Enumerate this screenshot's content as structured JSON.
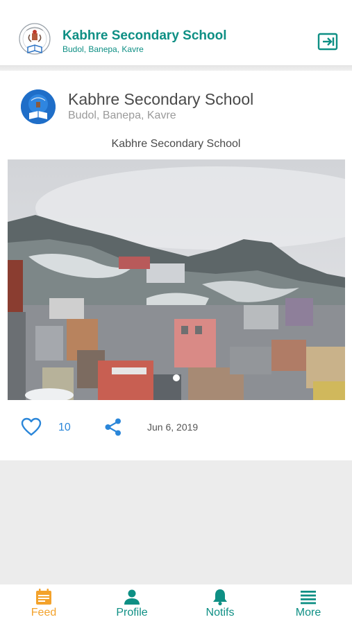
{
  "header": {
    "title": "Kabhre Secondary School",
    "subtitle": "Budol, Banepa, Kavre",
    "logo_icon": "school-logo-icon",
    "logout_icon": "logout-icon"
  },
  "post": {
    "author": "Kabhre Secondary School",
    "location": "Budol, Banepa, Kavre",
    "caption": "Kabhre Secondary School",
    "likes": "10",
    "date": "Jun 6, 2019",
    "like_icon": "heart-outline-icon",
    "share_icon": "share-icon"
  },
  "nav": {
    "items": [
      {
        "label": "Feed",
        "icon": "calendar-icon",
        "active": true
      },
      {
        "label": "Profile",
        "icon": "person-icon",
        "active": false
      },
      {
        "label": "Notifs",
        "icon": "bell-icon",
        "active": false
      },
      {
        "label": "More",
        "icon": "menu-icon",
        "active": false
      }
    ]
  },
  "colors": {
    "brand_teal": "#0e8f84",
    "active_orange": "#f3a22b",
    "accent_blue": "#2a86d9"
  }
}
